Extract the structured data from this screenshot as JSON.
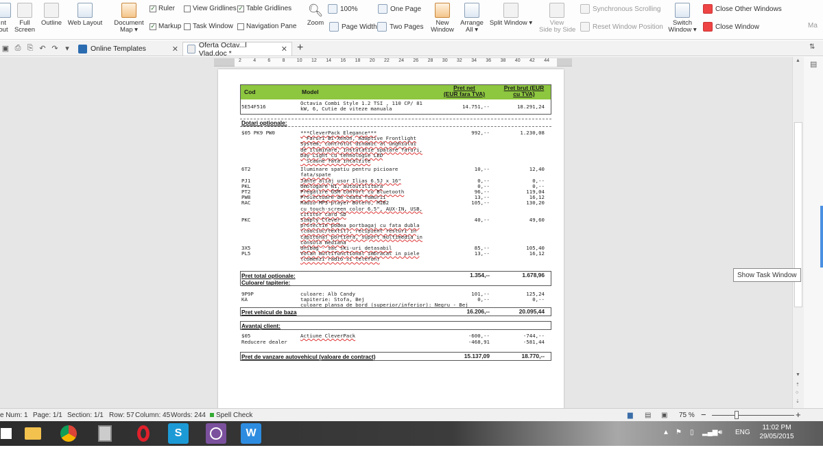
{
  "ribbon": {
    "print_layout_label": "nt\nout",
    "full_screen_label": "Full\nScreen",
    "outline_label": "Outline",
    "web_layout_label": "Web Layout",
    "document_map_label": "Document\nMap ▾",
    "ruler_label": "Ruler",
    "view_gridlines_label": "View Gridlines",
    "table_gridlines_label": "Table Gridlines",
    "markup_label": "Markup",
    "task_window_label": "Task Window",
    "navigation_pane_label": "Navigation Pane",
    "zoom_label": "Zoom",
    "zoom_100_label": "100%",
    "page_width_label": "Page Width",
    "one_page_label": "One Page",
    "two_pages_label": "Two Pages",
    "new_window_label": "New\nWindow",
    "arrange_all_label": "Arrange\nAll ▾",
    "split_window_label": "Split Window ▾",
    "view_side_by_side_label": "View\nSide by Side",
    "synchronous_scrolling_label": "Synchronous Scrolling",
    "reset_window_position_label": "Reset Window Position",
    "switch_window_label": "Switch\nWindow ▾",
    "close_other_windows_label": "Close Other Windows",
    "close_window_label": "Close Window",
    "macro_label": "Ma",
    "ruler_checked": true,
    "table_gridlines_checked": true,
    "markup_checked": true
  },
  "tabs": {
    "online_templates": "Online Templates",
    "document": "Oferta Octav...l Vlad.doc *",
    "close_glyph": "✕",
    "new_tab_glyph": "+"
  },
  "ruler_ticks": [
    "2",
    "4",
    "6",
    "8",
    "10",
    "12",
    "14",
    "16",
    "18",
    "20",
    "22",
    "24",
    "26",
    "28",
    "30",
    "32",
    "34",
    "36",
    "38",
    "40",
    "42",
    "44"
  ],
  "table": {
    "header": {
      "cod": "Cod",
      "model": "Model",
      "net": "Pret net\n(EUR fara TVA)",
      "brut": "Pret brut (EUR\ncu TVA)"
    },
    "vehicle": {
      "cod": "5E54F516",
      "model": "Octavia Combi Style 1.2 TSI , 110 CP/ 81\nkW, 6, Cutie de viteze manuala",
      "net": "14.751,--",
      "brut": "18.291,24"
    },
    "optional_title": "Dotari optionale:",
    "options": [
      {
        "cod": "$05 PK9 PW0",
        "desc": "***CleverPack Elegance***\n- Faruri Bi-Xenon, Adaptive Frontlight\nSystem, controlul dinamic al unghiului\nde iluminare, instalatie spalare faruri,\nDay Light cu tehnologie LED\n- Scaune fata incalzite",
        "net": "992,--",
        "brut": "1.230,08"
      },
      {
        "cod": "6T2",
        "desc": "Iluminare spatiu pentru picioare\nfata/spate",
        "net": "10,--",
        "brut": "12,40"
      },
      {
        "cod": "PJ1",
        "desc": "Jante aliaj usor Ilias 6.5J x 16\"",
        "net": "0,--",
        "brut": "0,--"
      },
      {
        "cod": "PKL",
        "desc": "Omologare N1, autoutilitara",
        "net": "0,--",
        "brut": "0,--"
      },
      {
        "cod": "PT2",
        "desc": "Pregatire GSM Confort cu Bluetooth",
        "net": "96,--",
        "brut": "119,04"
      },
      {
        "cod": "PW8",
        "desc": "Proiectoare de ceata fumurii",
        "net": "13,--",
        "brut": "16,12"
      },
      {
        "cod": "RAC",
        "desc": "Radio-MP3-player Bolero, MIB2\ncu touch-screen color 6.5\", AUX-IN, USB,\ncititor card SD",
        "net": "105,--",
        "brut": "130,20"
      },
      {
        "cod": "PKC",
        "desc": "Simply Clever\nprotectie podea portbagaj cu fata dubla\n(cauciuc/textil), recipient resturi in\ncapitona) portiera, suport multimedia in\nconsola mediana",
        "net": "40,--",
        "brut": "49,60"
      },
      {
        "cod": "3X5",
        "desc": "Unibag - sac ski-uri detasabil",
        "net": "85,--",
        "brut": "105,40"
      },
      {
        "cod": "PL5",
        "desc": "Volan multifunctional imbracat in piele\n(comenzi radio si telefon)",
        "net": "13,--",
        "brut": "16,12"
      }
    ],
    "total_optional": {
      "label": "Pret total optionale:",
      "net": "1.354,--",
      "brut": "1.678,96"
    },
    "color_title": "Culoare/ tapiterie:",
    "colors": [
      {
        "cod": "9P9P",
        "desc": "culoare: Alb Candy",
        "net": "101,--",
        "brut": "125,24"
      },
      {
        "cod": "KA",
        "desc": "tapiterie: Stofa, Bej",
        "net": "0,--",
        "brut": "0,--"
      },
      {
        "cod": "",
        "desc": "culoare plansa de bord (superior/inferior): Negru - Bej",
        "net": "",
        "brut": ""
      }
    ],
    "base_price": {
      "label": "Pret vehicul de baza",
      "net": "16.206,--",
      "brut": "20.095,44"
    },
    "advantage_title": "Avantaj client:",
    "advantages": [
      {
        "cod": "$05",
        "desc": "Actiune CleverPack",
        "net": "-600,--",
        "brut": "-744,--"
      },
      {
        "cod": "Reducere dealer",
        "desc": "",
        "net": "-468,91",
        "brut": "-581,44"
      }
    ],
    "sale_price": {
      "label": "Pret de vanzare autovehicul (valoare de contract)",
      "net": "15.137,09",
      "brut": "18.770,--"
    }
  },
  "tooltip": "Show Task Window",
  "status": {
    "page_num": "e Num: 1",
    "page": "Page: 1/1",
    "section": "Section: 1/1",
    "row": "Row: 57",
    "column": "Column: 45",
    "words": "Words: 244",
    "spell_check": "Spell Check",
    "zoom": "75 %",
    "zoom_fraction": 0.3
  },
  "taskbar": {
    "tray_lang": "ENG",
    "time": "11:02 PM",
    "date": "29/05/2015"
  },
  "colors": {
    "header_green": "#8dc63f",
    "accent_blue": "#4a90e2"
  }
}
